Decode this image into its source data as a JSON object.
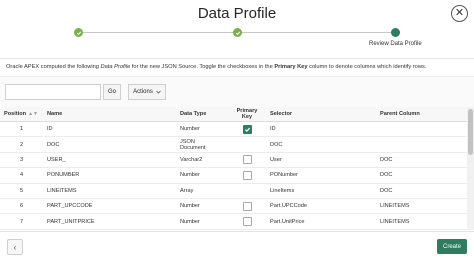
{
  "dialog": {
    "title": "Data Profile",
    "close_label": "✕"
  },
  "wizard": {
    "current_step_label": "Review Data Profile"
  },
  "help": {
    "part1": "Oracle APEX computed the following ",
    "part2": "Data Profile",
    "part3": " for the new JSON Source. Toggle the checkboxes in the ",
    "part4": "Primary Key",
    "part5": " column to denote columns which identify rows."
  },
  "toolbar": {
    "search_value": "",
    "go_label": "Go",
    "actions_label": "Actions"
  },
  "table": {
    "columns": {
      "position": "Position",
      "name": "Name",
      "data_type": "Data Type",
      "primary_key_line1": "Primary",
      "primary_key_line2": "Key",
      "selector": "Selector",
      "parent_column": "Parent Column"
    },
    "rows": [
      {
        "position": "1",
        "name": "ID",
        "data_type": "Number",
        "data_type2": "",
        "pk": true,
        "pk_shown": true,
        "selector": "ID",
        "parent": ""
      },
      {
        "position": "2",
        "name": "DOC",
        "data_type": "JSON",
        "data_type2": "Document",
        "pk": false,
        "pk_shown": false,
        "selector": "DOC",
        "parent": ""
      },
      {
        "position": "3",
        "name": "USER_",
        "data_type": "Varchar2",
        "data_type2": "",
        "pk": false,
        "pk_shown": true,
        "selector": "User",
        "parent": "DOC"
      },
      {
        "position": "4",
        "name": "PONUMBER",
        "data_type": "Number",
        "data_type2": "",
        "pk": false,
        "pk_shown": true,
        "selector": "PONumber",
        "parent": "DOC"
      },
      {
        "position": "5",
        "name": "LINEITEMS",
        "data_type": "Array",
        "data_type2": "",
        "pk": false,
        "pk_shown": false,
        "selector": "LineItems",
        "parent": "DOC"
      },
      {
        "position": "6",
        "name": "PART_UPCCODE",
        "data_type": "Number",
        "data_type2": "",
        "pk": false,
        "pk_shown": true,
        "selector": "Part.UPCCode",
        "parent": "LINEITEMS"
      },
      {
        "position": "7",
        "name": "PART_UNITPRICE",
        "data_type": "Number",
        "data_type2": "",
        "pk": false,
        "pk_shown": true,
        "selector": "Part.UnitPrice",
        "parent": "LINEITEMS"
      }
    ]
  },
  "footer": {
    "previous_label": "‹",
    "create_label": "Create"
  },
  "colors": {
    "accent": "#2e7d5f",
    "step_done": "#7cae4e"
  }
}
